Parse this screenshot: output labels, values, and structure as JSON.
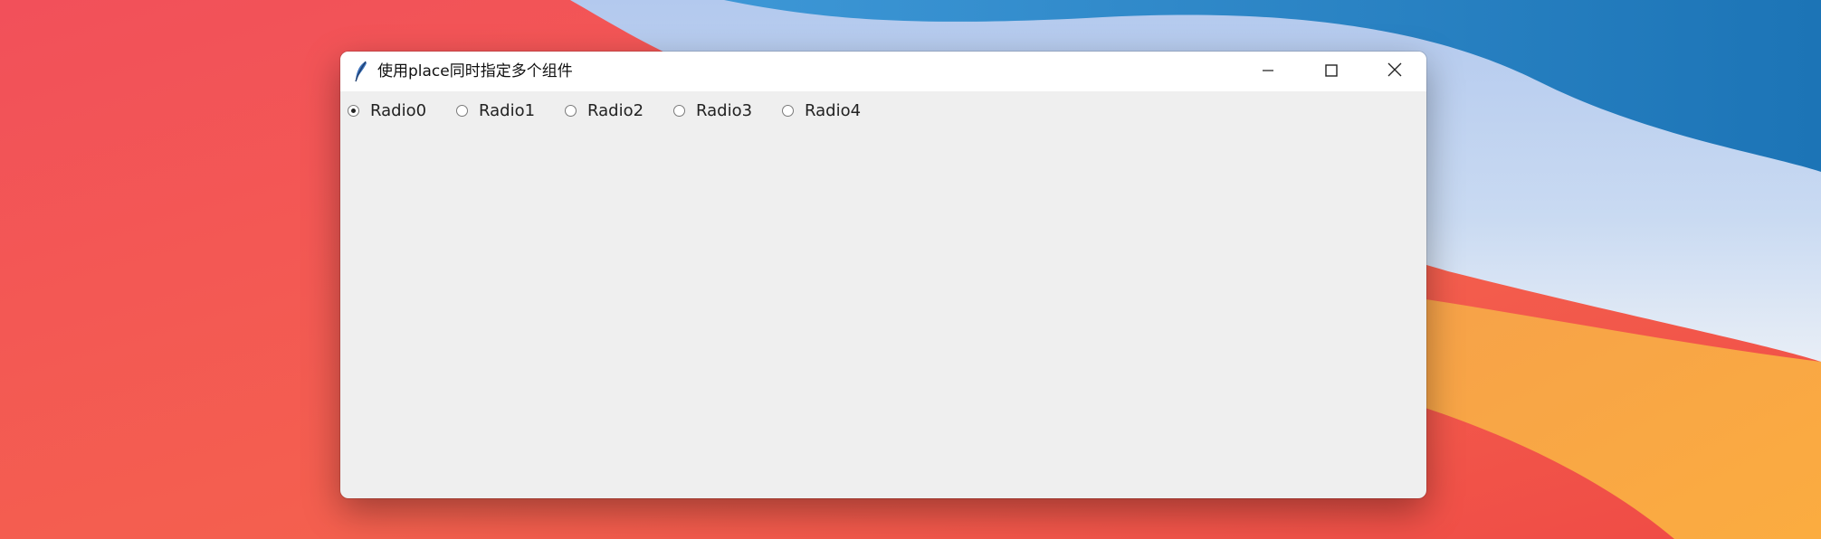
{
  "window": {
    "title": "使用place同时指定多个组件",
    "icon": "feather-icon",
    "controls": [
      "minimize-icon",
      "maximize-icon",
      "close-icon"
    ]
  },
  "radios": [
    {
      "label": "Radio0",
      "checked": true
    },
    {
      "label": "Radio1",
      "checked": false
    },
    {
      "label": "Radio2",
      "checked": false
    },
    {
      "label": "Radio3",
      "checked": false
    },
    {
      "label": "Radio4",
      "checked": false
    }
  ],
  "colors": {
    "client_bg": "#efefef",
    "titlebar_bg": "#ffffff"
  }
}
